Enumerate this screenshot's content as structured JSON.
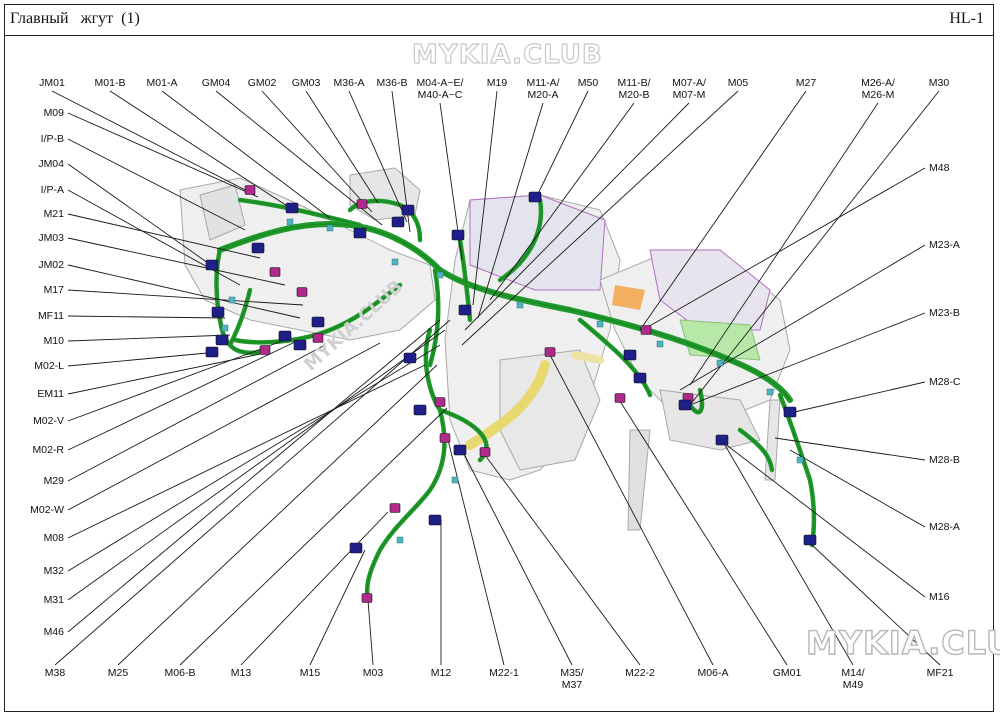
{
  "header": {
    "title": "Главный   жгут  (1)",
    "code": "HL-1"
  },
  "watermarks": {
    "top": "MYKIA.CLUB",
    "bottom": "MYKIA.CLUB",
    "diagonal": "MYKIA.CLUB"
  },
  "colors": {
    "harness": "#1f9a2a",
    "harness_dark": "#0c5d18",
    "leader": "#1a1a1a",
    "connector_blue": "#1f1f8a",
    "connector_magenta": "#b02a8e",
    "clip_teal": "#4fb3c0",
    "duct_yellow": "#e8d870",
    "dash_gray": "#e8e8e8"
  },
  "labels": {
    "top": [
      "JM01",
      "M01-B",
      "M01-A",
      "GM04",
      "GM02",
      "GM03",
      "M36-A",
      "M36-B",
      "M04-A~E/\nM40-A~C",
      "M19",
      "M11-A/\nM20-A",
      "M50",
      "M11-B/\nM20-B",
      "M07-A/\nM07-M",
      "M05",
      "M27",
      "M26-A/\nM26-M",
      "M30"
    ],
    "left": [
      "M09",
      "I/P-B",
      "JM04",
      "I/P-A",
      "M21",
      "JM03",
      "JM02",
      "M17",
      "MF11",
      "M10",
      "M02-L",
      "EM11",
      "M02-V",
      "M02-R",
      "M29",
      "M02-W",
      "M08",
      "M32",
      "M31",
      "M46"
    ],
    "right": [
      "M48",
      "M23-A",
      "M23-B",
      "M28-C",
      "M28-B",
      "M28-A",
      "M16"
    ],
    "bottom": [
      "M38",
      "M25",
      "M06-B",
      "M13",
      "M15",
      "M03",
      "M12",
      "M22-1",
      "M35/\nM37",
      "M22-2",
      "M06-A",
      "GM01",
      "M14/\nM49",
      "MF21"
    ]
  }
}
